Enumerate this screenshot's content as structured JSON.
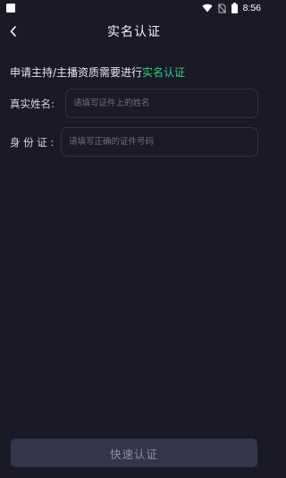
{
  "status_bar": {
    "time": "8:56",
    "icons": [
      "notification-square-icon",
      "wifi-icon",
      "no-sim-icon",
      "battery-icon"
    ]
  },
  "nav": {
    "title": "实名认证",
    "back_icon": "chevron-left-icon"
  },
  "intro": {
    "text": "申请主持/主播资质需要进行",
    "highlight": "实名认证",
    "highlight_color": "#2fd08a"
  },
  "form": {
    "name_label": "真实姓名:",
    "name_placeholder": "请填写证件上的姓名",
    "id_label": "身 份 证 :",
    "id_placeholder": "请填写正确的证件号码"
  },
  "submit": {
    "label": "快速认证"
  },
  "colors": {
    "background": "#1a1a25",
    "button_bg": "#34344a",
    "accent": "#2fd08a"
  }
}
